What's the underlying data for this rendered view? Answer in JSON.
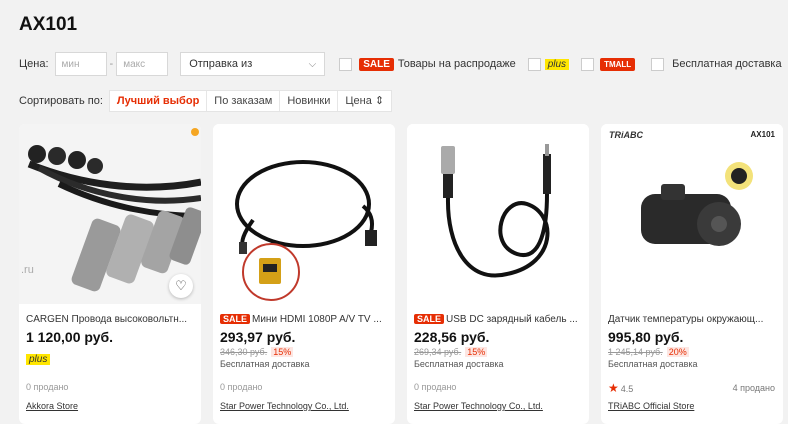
{
  "page": {
    "title": "AX101"
  },
  "filters": {
    "price_label": "Цена:",
    "min_placeholder": "мин",
    "max_placeholder": "макс",
    "ship_from": "Отправка из",
    "sale_badge": "SALE",
    "sale_label": "Товары на распродаже",
    "plus_badge": "plus",
    "tmall_badge": "TMALL",
    "free_shipping": "Бесплатная доставка"
  },
  "sort": {
    "label": "Сортировать по:",
    "options": [
      "Лучший выбор",
      "По заказам",
      "Новинки",
      "Цена ⇕"
    ]
  },
  "products": [
    {
      "name": "CARGEN Провода высоковольтн...",
      "price": "1 120,00 руб.",
      "plus": "plus",
      "sold": "0 продано",
      "store": "Akkora Store",
      "watermark": ".ru"
    },
    {
      "sale": "SALE",
      "name": "Мини HDMI 1080P A/V TV ...",
      "price": "293,97 руб.",
      "old_price": "346,30 руб.",
      "discount": "15%",
      "shipping": "Бесплатная доставка",
      "sold": "0 продано",
      "store": "Star Power Technology Co., Ltd."
    },
    {
      "sale": "SALE",
      "name": "USB DC зарядный кабель ...",
      "price": "228,56 руб.",
      "old_price": "269,34 руб.",
      "discount": "15%",
      "shipping": "Бесплатная доставка",
      "sold": "0 продано",
      "store": "Star Power Technology Co., Ltd."
    },
    {
      "name": "Датчик температуры окружающ...",
      "price": "995,80 руб.",
      "old_price": "1 245,14 руб.",
      "discount": "20%",
      "shipping": "Бесплатная доставка",
      "rating": "4.5",
      "sold": "4 продано",
      "store": "TRiABC Official Store",
      "brand_logo": "TRiABC",
      "model_code": "AX101"
    }
  ],
  "colors": {
    "accent": "#e62e04",
    "plus_yellow": "#ffe600"
  }
}
